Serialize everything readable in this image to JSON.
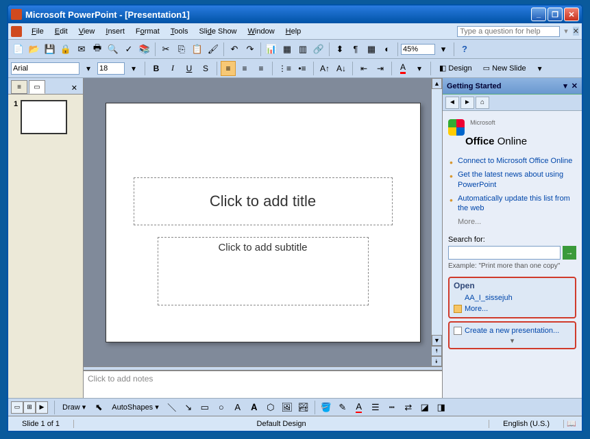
{
  "titlebar": {
    "title": "Microsoft PowerPoint - [Presentation1]"
  },
  "menu": {
    "file": "File",
    "edit": "Edit",
    "view": "View",
    "insert": "Insert",
    "format": "Format",
    "tools": "Tools",
    "slideshow": "Slide Show",
    "window": "Window",
    "help": "Help",
    "help_placeholder": "Type a question for help"
  },
  "toolbar": {
    "zoom": "45%"
  },
  "format": {
    "font": "Arial",
    "size": "18",
    "design_label": "Design",
    "newslide_label": "New Slide"
  },
  "outline": {
    "slide_number": "1"
  },
  "slide": {
    "title_placeholder": "Click to add title",
    "subtitle_placeholder": "Click to add subtitle"
  },
  "notes": {
    "placeholder": "Click to add notes"
  },
  "taskpane": {
    "title": "Getting Started",
    "office_brand_ms": "Microsoft",
    "office_brand_office": "Office",
    "office_brand_online": "Online",
    "links": {
      "connect": "Connect to Microsoft Office Online",
      "news": "Get the latest news about using PowerPoint",
      "update": "Automatically update this list from the web"
    },
    "more": "More...",
    "search_label": "Search for:",
    "example": "Example:  \"Print more than one copy\"",
    "open_header": "Open",
    "recent_file": "AA_I_sissejuh",
    "open_more": "More...",
    "create_new": "Create a new presentation..."
  },
  "drawbar": {
    "draw": "Draw",
    "autoshapes": "AutoShapes"
  },
  "status": {
    "slide": "Slide 1 of 1",
    "design": "Default Design",
    "lang": "English (U.S.)"
  }
}
